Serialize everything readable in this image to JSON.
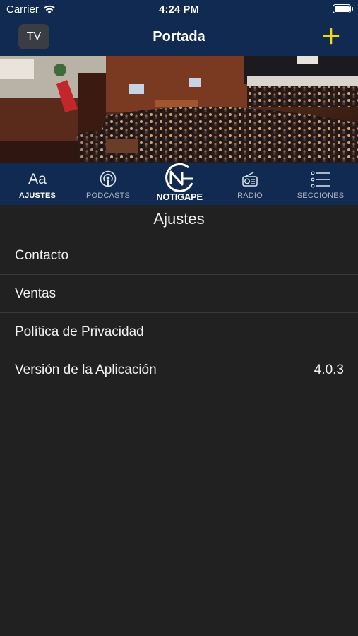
{
  "status": {
    "carrier": "Carrier",
    "time": "4:24 PM"
  },
  "nav": {
    "tv_label": "TV",
    "title": "Portada"
  },
  "tabs": [
    {
      "label": "AJUSTES",
      "icon": "text-size-icon",
      "glyph": "Aa",
      "active": true
    },
    {
      "label": "PODCASTS",
      "icon": "podcast-icon",
      "active": false
    },
    {
      "label": "RADIO",
      "icon": "radio-icon",
      "active": false
    },
    {
      "label": "SECCIONES",
      "icon": "list-icon",
      "active": false
    }
  ],
  "logo": {
    "text": "NOTIGAPE"
  },
  "settings": {
    "title": "Ajustes",
    "rows": [
      {
        "label": "Contacto",
        "value": ""
      },
      {
        "label": "Ventas",
        "value": ""
      },
      {
        "label": "Política de Privacidad",
        "value": ""
      },
      {
        "label": "Versión de la Aplicación",
        "value": "4.0.3"
      }
    ]
  },
  "colors": {
    "nav_bg": "#112a52",
    "content_bg": "#212121",
    "accent": "#f5d90a"
  }
}
